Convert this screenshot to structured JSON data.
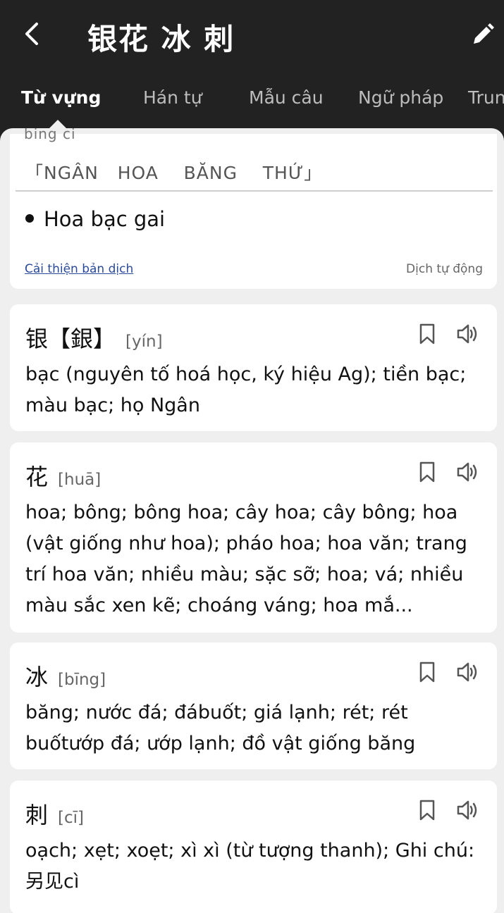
{
  "header": {
    "title": "银花 冰 刺",
    "back_icon": "chevron-left-icon",
    "edit_icon": "pencil-icon"
  },
  "tabs": [
    {
      "label": "Từ vựng",
      "active": true
    },
    {
      "label": "Hán tự",
      "active": false
    },
    {
      "label": "Mẫu câu",
      "active": false
    },
    {
      "label": "Ngữ pháp",
      "active": false
    },
    {
      "label": "Trun",
      "active": false
    }
  ],
  "translation_card": {
    "cut_text": "bing ci",
    "hanviet": "「NGÂN   HOA    BĂNG    THỨ」",
    "meaning": "Hoa bạc gai",
    "improve_link": "Cải thiện bản dịch",
    "auto_label": "Dịch tự động"
  },
  "characters": [
    {
      "char": "银【銀】",
      "pinyin": "[yín]",
      "meaning": "bạc (nguyên tố hoá học, ký hiệu Ag); tiền bạc; màu bạc; họ Ngân"
    },
    {
      "char": "花",
      "pinyin": "[huā]",
      "meaning": "hoa; bông; bông hoa; cây hoa; cây bông; hoa (vật giống như hoa); pháo hoa; hoa văn; trang trí hoa văn; nhiều màu; sặc sỡ; hoa; vá; nhiều màu sắc xen kẽ; choáng váng; hoa mắ..."
    },
    {
      "char": "冰",
      "pinyin": "[bīng]",
      "meaning": "băng; nước đá; đábuốt; giá lạnh; rét; rét buốtướp đá; ướp lạnh; đồ vật giống băng"
    },
    {
      "char": "刺",
      "pinyin": "[cī]",
      "meaning": "oạch; xẹt; xoẹt; xì xì (từ tượng thanh); Ghi chú: 另见cì"
    }
  ],
  "icons": {
    "bookmark": "bookmark-icon",
    "speaker": "speaker-icon"
  }
}
